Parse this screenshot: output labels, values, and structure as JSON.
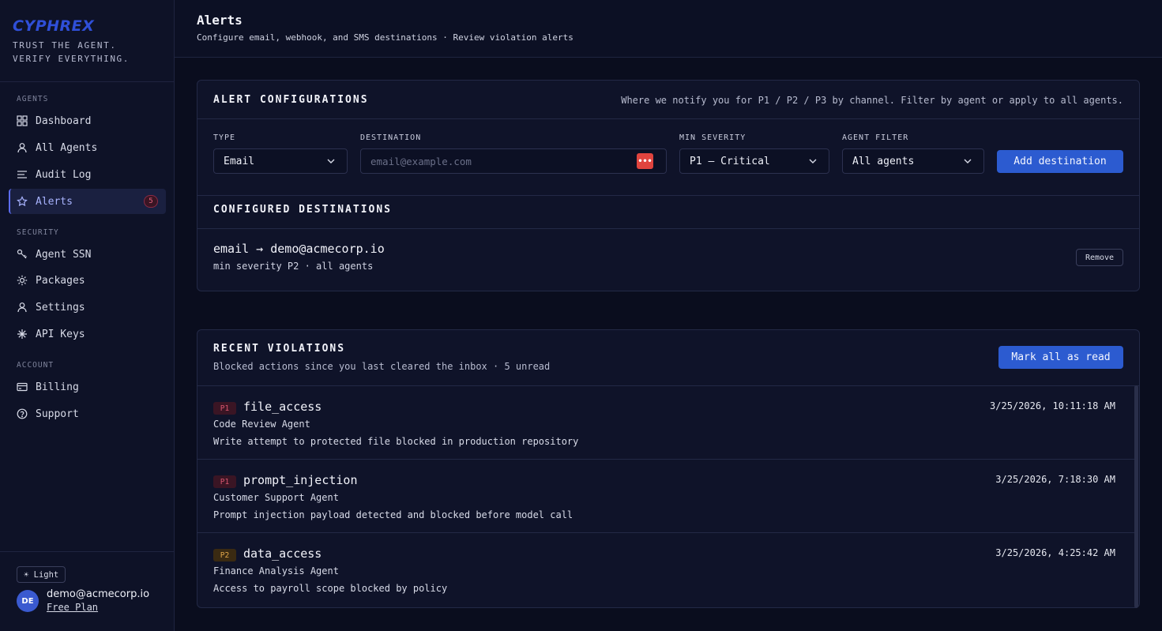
{
  "sidebar": {
    "logo": "CYPHREX",
    "tagline_1": "TRUST THE AGENT.",
    "tagline_2": "VERIFY EVERYTHING.",
    "sections": {
      "agents": "AGENTS",
      "security": "SECURITY",
      "account": "ACCOUNT"
    },
    "items": [
      {
        "label": "Dashboard",
        "icon": "grid-icon"
      },
      {
        "label": "All Agents",
        "icon": "user-icon"
      },
      {
        "label": "Audit Log",
        "icon": "list-icon"
      },
      {
        "label": "Alerts",
        "icon": "star-icon",
        "badge": "5",
        "active": true
      },
      {
        "label": "Agent SSN",
        "icon": "key-icon"
      },
      {
        "label": "Packages",
        "icon": "sun-icon"
      },
      {
        "label": "Settings",
        "icon": "user-icon"
      },
      {
        "label": "API Keys",
        "icon": "asterisk-icon"
      },
      {
        "label": "Billing",
        "icon": "card-icon"
      },
      {
        "label": "Support",
        "icon": "help-icon"
      }
    ],
    "theme_toggle": "☀ Light",
    "user": {
      "initials": "DE",
      "email": "demo@acmecorp.io",
      "plan": "Free Plan"
    }
  },
  "header": {
    "title": "Alerts",
    "subtitle": "Configure email, webhook, and SMS destinations · Review violation alerts"
  },
  "config": {
    "title": "ALERT CONFIGURATIONS",
    "hint": "Where we notify you for P1 / P2 / P3 by channel. Filter by agent or apply to all agents.",
    "type_label": "TYPE",
    "type_value": "Email",
    "destination_label": "DESTINATION",
    "destination_value": "",
    "destination_placeholder": "email@example.com",
    "severity_label": "MIN SEVERITY",
    "severity_value": "P1 — Critical",
    "agent_label": "AGENT FILTER",
    "agent_value": "All agents",
    "add_button": "Add destination",
    "configured_title": "CONFIGURED DESTINATIONS",
    "destinations": [
      {
        "main": "email → demo@acmecorp.io",
        "sub": "min severity P2 · all agents",
        "remove": "Remove"
      }
    ]
  },
  "violations": {
    "title": "RECENT VIOLATIONS",
    "subtitle": "Blocked actions since you last cleared the inbox · 5 unread",
    "mark_read_button": "Mark all as read",
    "colors": {
      "p1": "#d9566f",
      "p2": "#e0a64a"
    },
    "items": [
      {
        "severity": "P1",
        "type": "file_access",
        "time": "3/25/2026, 10:11:18 AM",
        "agent": "Code Review Agent",
        "description": "Write attempt to protected file blocked in production repository"
      },
      {
        "severity": "P1",
        "type": "prompt_injection",
        "time": "3/25/2026, 7:18:30 AM",
        "agent": "Customer Support Agent",
        "description": "Prompt injection payload detected and blocked before model call"
      },
      {
        "severity": "P2",
        "type": "data_access",
        "time": "3/25/2026, 4:25:42 AM",
        "agent": "Finance Analysis Agent",
        "description": "Access to payroll scope blocked by policy"
      }
    ]
  }
}
